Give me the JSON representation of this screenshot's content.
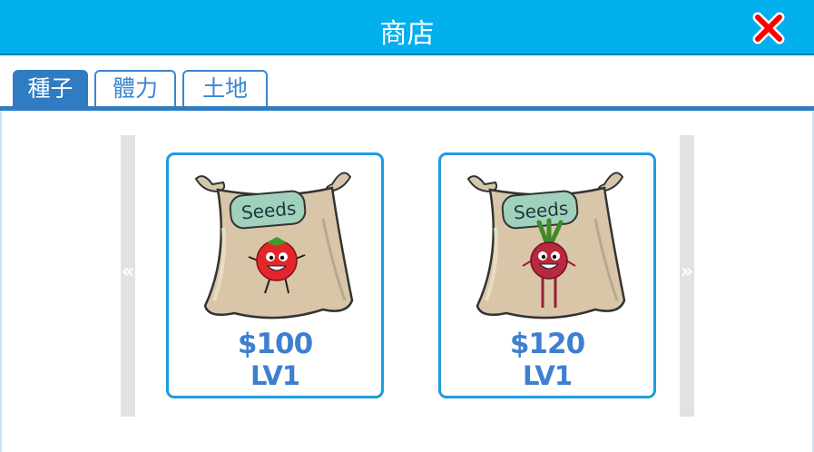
{
  "header": {
    "title": "商店"
  },
  "tabs": [
    {
      "label": "種子",
      "active": true
    },
    {
      "label": "體力",
      "active": false
    },
    {
      "label": "土地",
      "active": false
    }
  ],
  "nav": {
    "prev_glyph": "«",
    "next_glyph": "»"
  },
  "items": [
    {
      "bag_label": "Seeds",
      "crop_icon": "tomato-icon",
      "price": "$100",
      "level": "LV1"
    },
    {
      "bag_label": "Seeds",
      "crop_icon": "beet-icon",
      "price": "$120",
      "level": "LV1"
    }
  ],
  "colors": {
    "header": "#01b0ed",
    "tab_active": "#2f7cc3",
    "card_border": "#1e9be0",
    "price_text": "#3e7fcf",
    "close_x": "#ff0000"
  }
}
